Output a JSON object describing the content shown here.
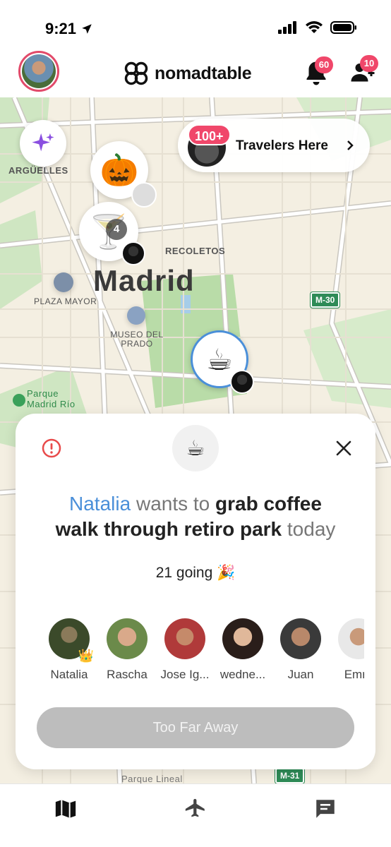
{
  "status_bar": {
    "time": "9:21"
  },
  "header": {
    "logo_text": "nomadtable",
    "notifications_count": "60",
    "friends_count": "10"
  },
  "map": {
    "city": "Madrid",
    "labels": {
      "arguelles": "ARGÜELLES",
      "recoletos": "RECOLETOS",
      "plaza_mayor": "PLAZA MAYOR",
      "museo_del_prado": "MUSEO DEL PRADO",
      "parque_madrid_rio": "Parque Madrid Río",
      "parque_lineal": "Parque Lineal"
    },
    "route_signs": {
      "m30": "M-30",
      "m31": "M-31"
    },
    "travelers_banner": {
      "count": "100+",
      "label": "Travelers Here"
    },
    "pins": {
      "pumpkin": "🎃",
      "martini": "🍸",
      "martini_count": "4",
      "coffee": "☕"
    }
  },
  "card": {
    "emoji": "☕",
    "host": "Natalia",
    "wants_to": "wants to",
    "activity_line1": "grab coffee",
    "activity_line2": "walk through retiro park",
    "when": "today",
    "going": "21 going 🎉",
    "attendees": [
      {
        "name": "Natalia",
        "crown": "👑"
      },
      {
        "name": "Rascha"
      },
      {
        "name": "Jose Ig..."
      },
      {
        "name": "wedne..."
      },
      {
        "name": "Juan"
      },
      {
        "name": "Emre"
      }
    ],
    "button_label": "Too Far Away"
  },
  "colors": {
    "accent_pink": "#f0476a",
    "link_blue": "#4a8fd9",
    "button_disabled": "#bdbdbd"
  },
  "icons": [
    "location-arrow-icon",
    "signal-icon",
    "wifi-icon",
    "battery-icon",
    "bell-icon",
    "friends-icon",
    "sparkles-icon",
    "alert-circle-icon",
    "close-icon",
    "map-icon",
    "plane-icon",
    "chat-icon"
  ]
}
